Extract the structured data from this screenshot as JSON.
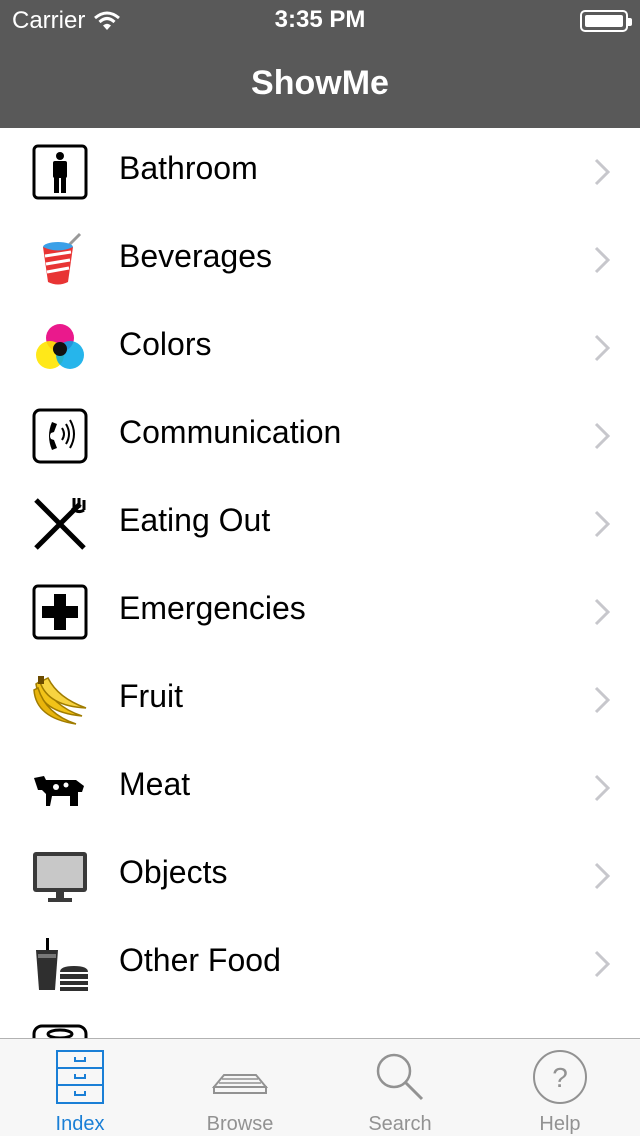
{
  "status_bar": {
    "carrier": "Carrier",
    "time": "3:35 PM"
  },
  "nav": {
    "title": "ShowMe"
  },
  "list": {
    "items": [
      {
        "label": "Bathroom",
        "icon": "bathroom-icon"
      },
      {
        "label": "Beverages",
        "icon": "beverage-cup-icon"
      },
      {
        "label": "Colors",
        "icon": "color-circles-icon"
      },
      {
        "label": "Communication",
        "icon": "telephone-icon"
      },
      {
        "label": "Eating Out",
        "icon": "fork-knife-icon"
      },
      {
        "label": "Emergencies",
        "icon": "first-aid-cross-icon"
      },
      {
        "label": "Fruit",
        "icon": "bananas-icon"
      },
      {
        "label": "Meat",
        "icon": "cow-icon"
      },
      {
        "label": "Objects",
        "icon": "monitor-icon"
      },
      {
        "label": "Other Food",
        "icon": "drink-burger-icon"
      }
    ]
  },
  "tabs": [
    {
      "label": "Index",
      "icon": "file-cabinet-icon",
      "active": true
    },
    {
      "label": "Browse",
      "icon": "browse-tray-icon",
      "active": false
    },
    {
      "label": "Search",
      "icon": "magnifier-icon",
      "active": false
    },
    {
      "label": "Help",
      "icon": "question-icon",
      "active": false
    }
  ],
  "colors": {
    "nav_bg": "#595959",
    "tab_active": "#1a7fd6",
    "tab_inactive": "#929292",
    "chevron": "#c7c7cc"
  }
}
